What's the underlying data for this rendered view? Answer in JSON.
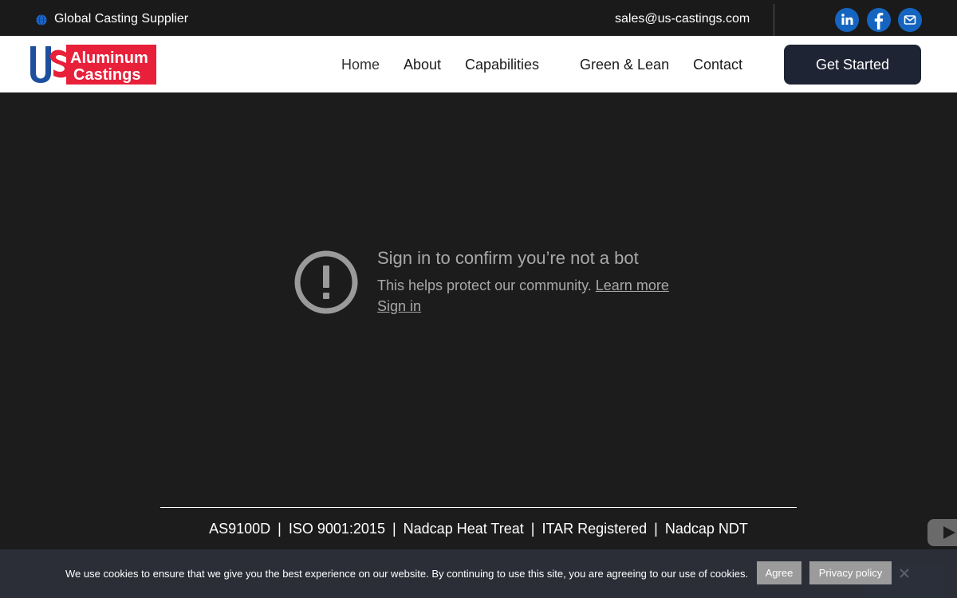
{
  "topbar": {
    "tagline": "Global Casting Supplier",
    "email": "sales@us-castings.com",
    "social": [
      "linkedin-icon",
      "facebook-icon",
      "mail-icon"
    ]
  },
  "header": {
    "logo": {
      "us": "US",
      "line1": "Aluminum",
      "line2": "Castings"
    },
    "nav": [
      {
        "label": "Home"
      },
      {
        "label": "About"
      },
      {
        "label": "Capabilities"
      },
      {
        "label": "Green & Lean"
      },
      {
        "label": "Contact"
      }
    ],
    "cta_label": "Get Started"
  },
  "video_error": {
    "title": "Sign in to confirm you’re not a bot",
    "description": "This helps protect our community.",
    "learn_more": "Learn more",
    "sign_in": "Sign in"
  },
  "certifications": [
    "AS9100D",
    "ISO 9001:2015",
    "Nadcap Heat Treat",
    "ITAR Registered",
    "Nadcap NDT"
  ],
  "cookie_bar": {
    "message": "We use cookies to ensure that we give you the best experience on our website. By continuing to use this site, you are agreeing to our use of cookies.",
    "agree_label": "Agree",
    "privacy_label": "Privacy policy"
  },
  "colors": {
    "page_bg": "#1c1c1d",
    "topbar_bg": "#1a1a1a",
    "social_blue": "#1565c0",
    "cta_bg": "#1e2433",
    "logo_red": "#e8203a",
    "logo_blue": "#1d4f9e"
  }
}
